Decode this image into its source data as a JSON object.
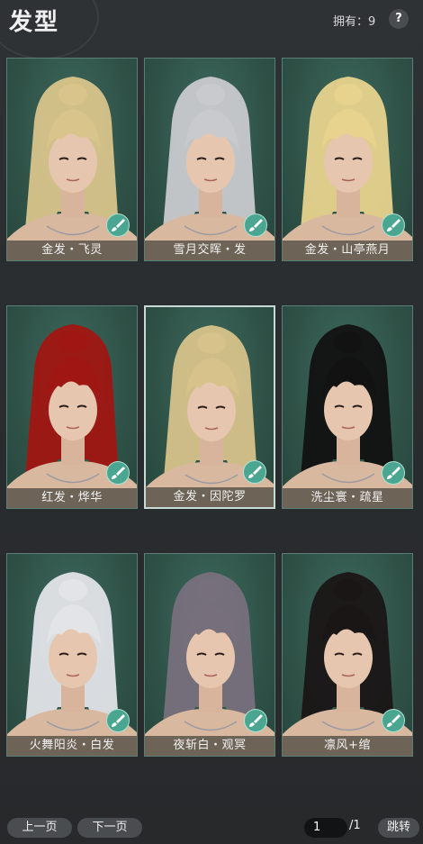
{
  "header": {
    "title": "发型",
    "owned_label": "拥有：9",
    "help": "?"
  },
  "hairstyles": [
    {
      "name": "金发・飞灵",
      "hair_color": "#d9c48b",
      "selected": false
    },
    {
      "name": "雪月交晖・发",
      "hair_color": "#c9cacd",
      "selected": false
    },
    {
      "name": "金发・山亭燕月",
      "hair_color": "#e7d38d",
      "selected": false
    },
    {
      "name": "红发・烨华",
      "hair_color": "#a01612",
      "selected": false
    },
    {
      "name": "金发・因陀罗",
      "hair_color": "#d6c28a",
      "selected": true
    },
    {
      "name": "洗尘寰・疏星",
      "hair_color": "#121212",
      "selected": false
    },
    {
      "name": "火舞阳炎・白发",
      "hair_color": "#e2e4e8",
      "selected": false
    },
    {
      "name": "夜斩白・观冥",
      "hair_color": "#77707c",
      "selected": false
    },
    {
      "name": "凛风+绾",
      "hair_color": "#1a1616",
      "selected": false
    }
  ],
  "footer": {
    "prev_page": "上一页",
    "next_page": "下一页",
    "page_input": "1",
    "page_total": "/1",
    "jump": "跳转"
  }
}
